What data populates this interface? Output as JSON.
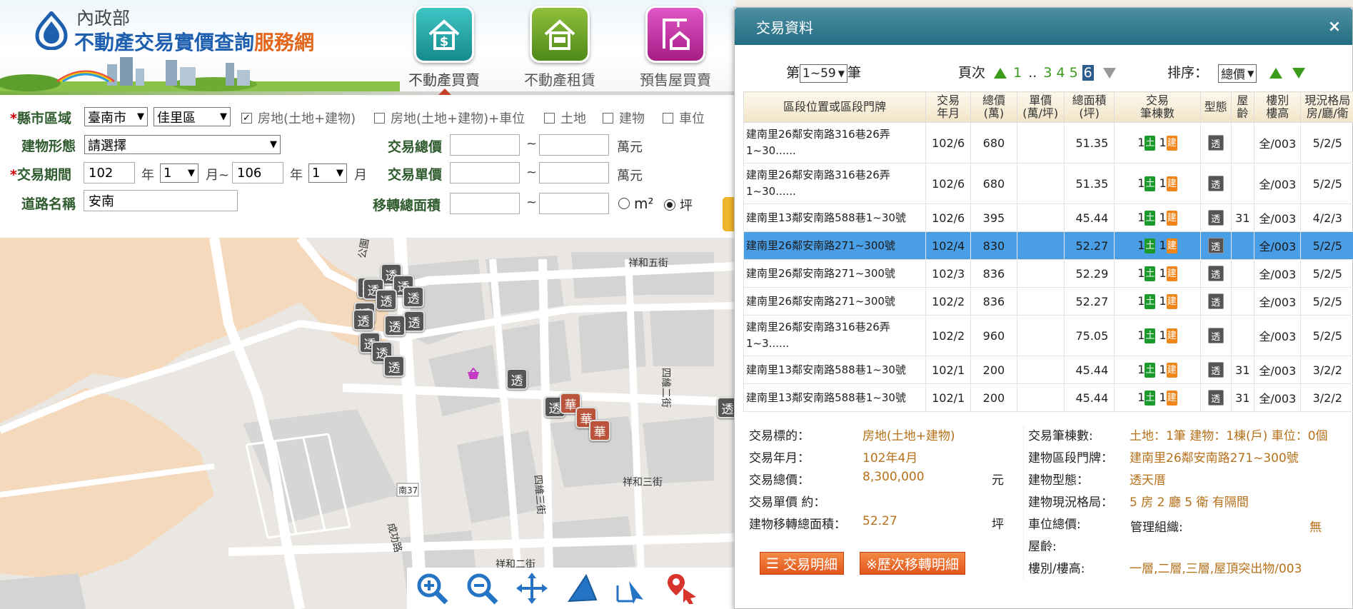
{
  "header": {
    "ministry": "內政部",
    "title_main": "不動產交易實價查詢",
    "title_accent": "服務網",
    "nav": [
      {
        "id": "buy",
        "label": "不動產買賣"
      },
      {
        "id": "rent",
        "label": "不動產租賃"
      },
      {
        "id": "presale",
        "label": "預售屋買賣"
      }
    ]
  },
  "form": {
    "county_label": "縣市區域",
    "county_value": "臺南市",
    "district_value": "佳里區",
    "targets": [
      {
        "label": "房地(土地+建物)",
        "checked": true
      },
      {
        "label": "房地(土地+建物)+車位",
        "checked": false
      },
      {
        "label": "土地",
        "checked": false
      },
      {
        "label": "建物",
        "checked": false
      },
      {
        "label": "車位",
        "checked": false
      }
    ],
    "building_type_label": "建物形態",
    "building_type_value": "請選擇",
    "period_label": "交易期間",
    "period_from_year": "102",
    "period_from_month": "1",
    "period_to_year": "106",
    "period_to_month": "1",
    "year_unit": "年",
    "month_unit_from": "月~",
    "month_unit_to": "月",
    "road_label": "道路名稱",
    "road_value": "安南",
    "total_price_label": "交易總價",
    "unit_price_label": "交易單價",
    "area_label": "移轉總面積",
    "tilde": "~",
    "wan_unit": "萬元",
    "area_unit_m2": "m²",
    "area_unit_ping": "坪"
  },
  "map": {
    "roads": [
      "祥和五街",
      "四維二街",
      "祥和三街",
      "四維三街",
      "成功路",
      "祥和二街",
      "公園",
      "南37"
    ],
    "marker_tou": "透",
    "marker_hua": "華"
  },
  "panel": {
    "title": "交易資料",
    "close": "×",
    "range_prefix": "第",
    "range_value": "1~59",
    "range_suffix": "筆",
    "page_label": "頁次",
    "pages": [
      "1",
      "..",
      "3",
      "4",
      "5",
      "6"
    ],
    "current_page": "6",
    "sort_label": "排序：",
    "sort_value": "總價",
    "columns": [
      "區段位置或區段門牌",
      "交易\n年月",
      "總價\n(萬)",
      "單價\n(萬/坪)",
      "總面積\n(坪)",
      "交易\n筆棟數",
      "型態",
      "屋\n齡",
      "樓別\n樓高",
      "現況格局\n房/廳/衛"
    ],
    "rows": [
      {
        "loc": "建南里26鄰安南路316巷26弄1~30......",
        "ym": "102/6",
        "total": "680",
        "unit": "",
        "area": "51.35",
        "land": "1",
        "bldg": "1",
        "type": "透",
        "age": "",
        "floor": "全/003",
        "layout": "5/2/5",
        "tall": true,
        "sel": false
      },
      {
        "loc": "建南里26鄰安南路316巷26弄1~30......",
        "ym": "102/6",
        "total": "680",
        "unit": "",
        "area": "51.35",
        "land": "1",
        "bldg": "1",
        "type": "透",
        "age": "",
        "floor": "全/003",
        "layout": "5/2/5",
        "tall": true,
        "sel": false
      },
      {
        "loc": "建南里13鄰安南路588巷1~30號",
        "ym": "102/6",
        "total": "395",
        "unit": "",
        "area": "45.44",
        "land": "1",
        "bldg": "1",
        "type": "透",
        "age": "31",
        "floor": "全/003",
        "layout": "4/2/3",
        "tall": false,
        "sel": false
      },
      {
        "loc": "建南里26鄰安南路271~300號",
        "ym": "102/4",
        "total": "830",
        "unit": "",
        "area": "52.27",
        "land": "1",
        "bldg": "1",
        "type": "透",
        "age": "",
        "floor": "全/003",
        "layout": "5/2/5",
        "tall": false,
        "sel": true
      },
      {
        "loc": "建南里26鄰安南路271~300號",
        "ym": "102/3",
        "total": "836",
        "unit": "",
        "area": "52.29",
        "land": "1",
        "bldg": "1",
        "type": "透",
        "age": "",
        "floor": "全/003",
        "layout": "5/2/5",
        "tall": false,
        "sel": false
      },
      {
        "loc": "建南里26鄰安南路271~300號",
        "ym": "102/2",
        "total": "836",
        "unit": "",
        "area": "52.27",
        "land": "1",
        "bldg": "1",
        "type": "透",
        "age": "",
        "floor": "全/003",
        "layout": "5/2/5",
        "tall": false,
        "sel": false
      },
      {
        "loc": "建南里26鄰安南路316巷26弄1~3......",
        "ym": "102/2",
        "total": "960",
        "unit": "",
        "area": "75.05",
        "land": "1",
        "bldg": "1",
        "type": "透",
        "age": "",
        "floor": "全/003",
        "layout": "5/2/5",
        "tall": true,
        "sel": false
      },
      {
        "loc": "建南里13鄰安南路588巷1~30號",
        "ym": "102/1",
        "total": "200",
        "unit": "",
        "area": "45.44",
        "land": "1",
        "bldg": "1",
        "type": "透",
        "age": "31",
        "floor": "全/003",
        "layout": "3/2/2",
        "tall": false,
        "sel": false
      },
      {
        "loc": "建南里13鄰安南路588巷1~30號",
        "ym": "102/1",
        "total": "200",
        "unit": "",
        "area": "45.44",
        "land": "1",
        "bldg": "1",
        "type": "透",
        "age": "31",
        "floor": "全/003",
        "layout": "3/2/2",
        "tall": false,
        "sel": false
      }
    ],
    "badge_land": "土",
    "badge_bldg": "建",
    "detail_left": [
      {
        "label": "交易標的：",
        "value": "房地(土地+建物)",
        "unit": ""
      },
      {
        "label": "交易年月：",
        "value": "102年4月",
        "unit": ""
      },
      {
        "label": "交易總價：",
        "value": "8,300,000",
        "unit": "元"
      },
      {
        "label": "交易單價 約：",
        "value": "",
        "unit": ""
      },
      {
        "label": "建物移轉總面積：",
        "value": "52.27",
        "unit": "坪"
      }
    ],
    "detail_right": [
      {
        "label": "交易筆棟數:",
        "value": "土地：1筆 建物：1棟(戶) 車位：0個"
      },
      {
        "label": "建物區段門牌：",
        "value": "建南里26鄰安南路271~300號"
      },
      {
        "label": "建物型態：",
        "value": "透天厝"
      },
      {
        "label": "建物現況格局：",
        "value": "5 房 2 廳 5 衛 有隔間"
      },
      {
        "label": "車位總價:",
        "value": ""
      },
      {
        "label": "屋齡:",
        "value": ""
      },
      {
        "label": "樓別/樓高:",
        "value": "一層,二層,三層,屋頂突出物/003"
      }
    ],
    "mgmt_label": "管理組織:",
    "mgmt_value": "無",
    "btn_detail": "交易明細",
    "btn_history": "※歷次移轉明細"
  }
}
